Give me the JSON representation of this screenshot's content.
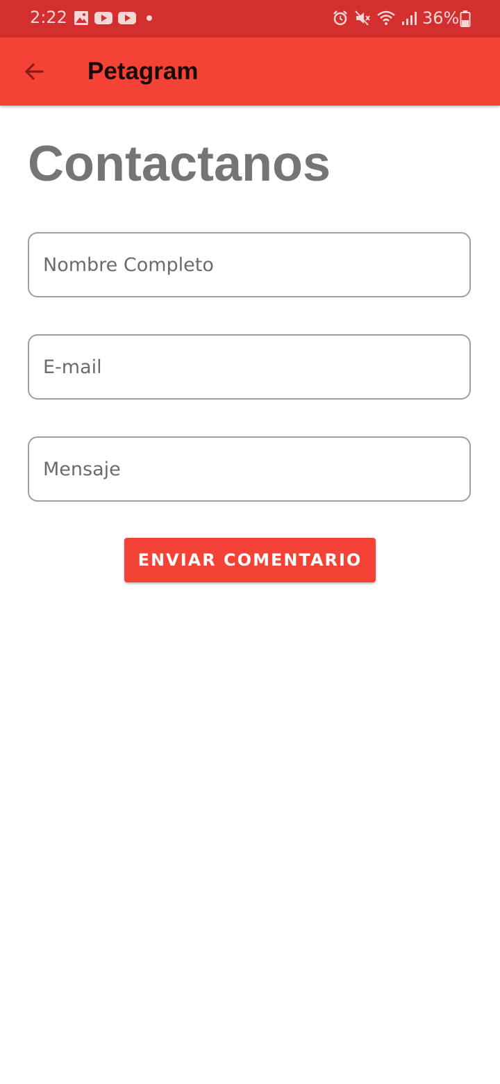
{
  "status_bar": {
    "time": "2:22",
    "battery_percent": "36%",
    "left_icons": [
      "gallery-icon",
      "youtube-icon",
      "youtube-icon",
      "dot-icon"
    ],
    "right_icons": [
      "alarm-icon",
      "mute-icon",
      "wifi-icon",
      "signal-icon",
      "battery-icon"
    ],
    "color": "#d32f2f"
  },
  "app_bar": {
    "title": "Petagram",
    "back_icon": "arrow-back-icon",
    "color": "#f44336"
  },
  "page": {
    "title": "Contactanos"
  },
  "form": {
    "name_placeholder": "Nombre Completo",
    "name_value": "",
    "email_placeholder": "E-mail",
    "email_value": "",
    "message_placeholder": "Mensaje",
    "message_value": "",
    "submit_label": "ENVIAR COMENTARIO"
  },
  "colors": {
    "accent": "#f44336",
    "status_bar": "#d32f2f",
    "title_text": "#757575",
    "field_border": "#9e9e9e"
  }
}
